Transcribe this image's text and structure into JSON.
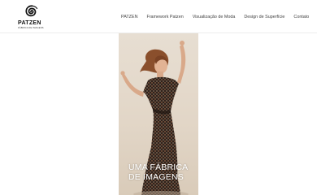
{
  "brand": {
    "name": "PATZEN",
    "tagline": "FÁBRICA DE IMAGENS"
  },
  "nav": {
    "items": [
      {
        "label": "PATZEN"
      },
      {
        "label": "Framework Patzen"
      },
      {
        "label": "Visualização de Moda"
      },
      {
        "label": "Design de Superfície"
      },
      {
        "label": "Contato"
      }
    ]
  },
  "hero": {
    "title_line1": "UMA FÁBRICA",
    "title_line2": "DE IMAGENS"
  },
  "colors": {
    "background": "#ffffff",
    "hero_bg": "#e2d6c7",
    "dress": "#3a2a22"
  }
}
